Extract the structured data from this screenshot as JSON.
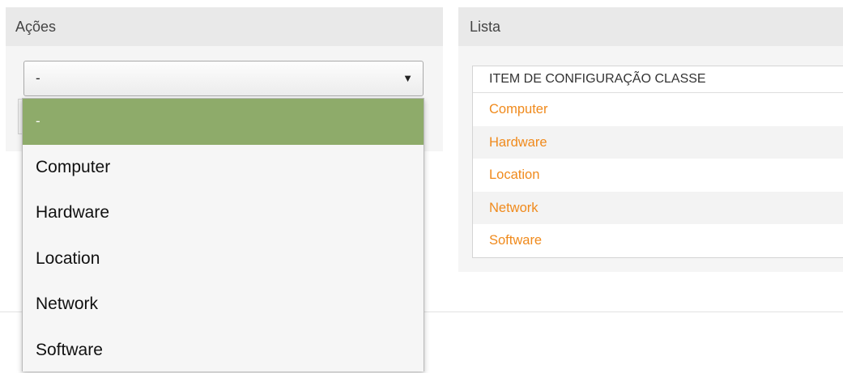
{
  "actions_panel": {
    "title": "Ações",
    "select": {
      "value": "-",
      "arrow": "▼",
      "options": [
        {
          "label": "-",
          "selected": true
        },
        {
          "label": "Computer",
          "selected": false
        },
        {
          "label": "Hardware",
          "selected": false
        },
        {
          "label": "Location",
          "selected": false
        },
        {
          "label": "Network",
          "selected": false
        },
        {
          "label": "Software",
          "selected": false
        }
      ]
    }
  },
  "list_panel": {
    "title": "Lista",
    "column_header": "ITEM DE CONFIGURAÇÃO CLASSE",
    "rows": [
      "Computer",
      "Hardware",
      "Location",
      "Network",
      "Software"
    ]
  },
  "colors": {
    "selected_option_bg": "#8eab6a",
    "link_color": "#f08a1c",
    "panel_header_bg": "#e9e9e9",
    "panel_bg": "#f5f5f5"
  }
}
